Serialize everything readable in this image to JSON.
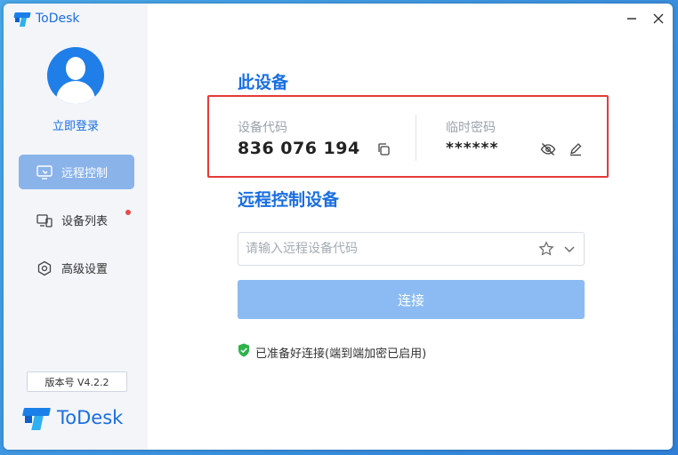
{
  "app": {
    "name": "ToDesk"
  },
  "sidebar": {
    "login_label": "立即登录",
    "items": [
      {
        "label": "远程控制",
        "icon": "remote-control-icon",
        "active": true
      },
      {
        "label": "设备列表",
        "icon": "device-list-icon",
        "badge": true
      },
      {
        "label": "高级设置",
        "icon": "settings-icon"
      }
    ],
    "version": "版本号 V4.2.2",
    "brand": "ToDesk"
  },
  "this_device": {
    "title": "此设备",
    "code_label": "设备代码",
    "code_value": "836 076 194",
    "password_label": "临时密码",
    "password_value": "******"
  },
  "remote": {
    "title": "远程控制设备",
    "placeholder": "请输入远程设备代码",
    "connect_label": "连接",
    "status": "已准备好连接(端到端加密已启用)"
  },
  "colors": {
    "accent": "#1a6fe0",
    "nav_active": "#8ab3ea",
    "connect_btn": "#8bbbf2",
    "highlight_border": "#e53a3a",
    "status_ok": "#2db34a"
  }
}
